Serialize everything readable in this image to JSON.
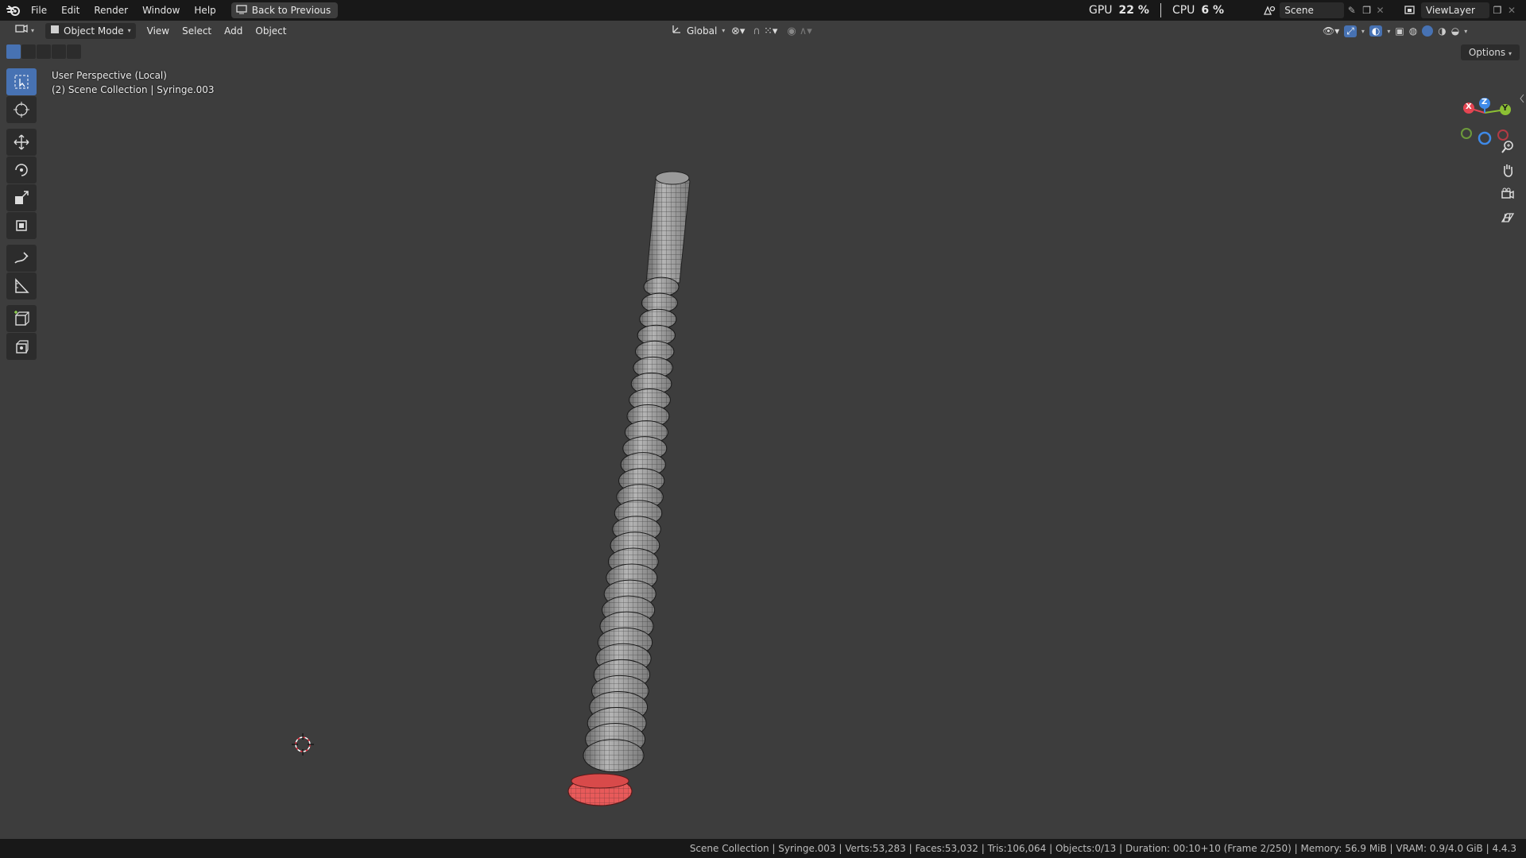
{
  "menu": [
    "File",
    "Edit",
    "Render",
    "Window",
    "Help"
  ],
  "back_button": "Back to Previous",
  "perf": {
    "gpu_label": "GPU",
    "gpu_value": "22 %",
    "cpu_label": "CPU",
    "cpu_value": "6 %"
  },
  "scene": "Scene",
  "view_layer": "ViewLayer",
  "viewport_header": {
    "mode": "Object Mode",
    "menus": [
      "View",
      "Select",
      "Add",
      "Object"
    ],
    "transform_orientation": "Global",
    "options": "Options"
  },
  "overlay": {
    "perspective": "User Perspective (Local)",
    "collection": "(2) Scene Collection | Syringe.003"
  },
  "gizmo": {
    "x": "X",
    "y": "Y",
    "z": "Z"
  },
  "status": "Scene Collection | Syringe.003 | Verts:53,283 | Faces:53,032 | Tris:106,064 | Objects:0/13 | Duration: 00:10+10 (Frame 2/250) | Memory: 56.9 MiB | VRAM: 0.9/4.0 GiB | 4.4.3",
  "colors": {
    "accent": "#4772b3",
    "axis_x": "#e54552",
    "axis_y": "#8cc034",
    "axis_z": "#3f8ae8",
    "selected_face": "#e85a5a"
  },
  "tools": [
    "select-box-icon",
    "cursor-icon",
    "move-icon",
    "rotate-icon",
    "scale-icon",
    "transform-icon",
    "annotate-icon",
    "measure-icon",
    "add-cube-icon",
    "add-primitive-icon"
  ]
}
